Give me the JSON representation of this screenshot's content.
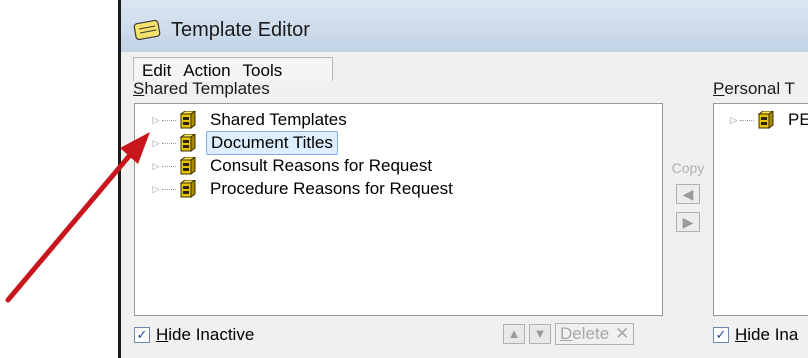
{
  "window": {
    "title": "Template Editor"
  },
  "menu": [
    "Edit",
    "Action",
    "Tools"
  ],
  "shared": {
    "label_underlined": "S",
    "label_rest": "hared Templates",
    "items": [
      {
        "label": "Shared Templates",
        "selected": false
      },
      {
        "label": "Document Titles",
        "selected": true
      },
      {
        "label": "Consult Reasons for Request",
        "selected": false
      },
      {
        "label": "Procedure Reasons for Request",
        "selected": false
      }
    ],
    "hide_inactive_underlined": "H",
    "hide_inactive_rest": "ide Inactive",
    "hide_inactive_checked": true,
    "delete_underlined": "D",
    "delete_rest": "elete"
  },
  "copy": {
    "label": "Copy"
  },
  "personal": {
    "label_underlined": "P",
    "label_rest": "ersonal T",
    "items": [
      {
        "label": "PE"
      }
    ],
    "hide_inactive_underlined": "H",
    "hide_inactive_rest": "ide Ina",
    "hide_inactive_checked": true
  },
  "colors": {
    "annotation_arrow": "#c8161d",
    "selection_fill": "#ddeeff",
    "selection_border": "#84acdd"
  }
}
